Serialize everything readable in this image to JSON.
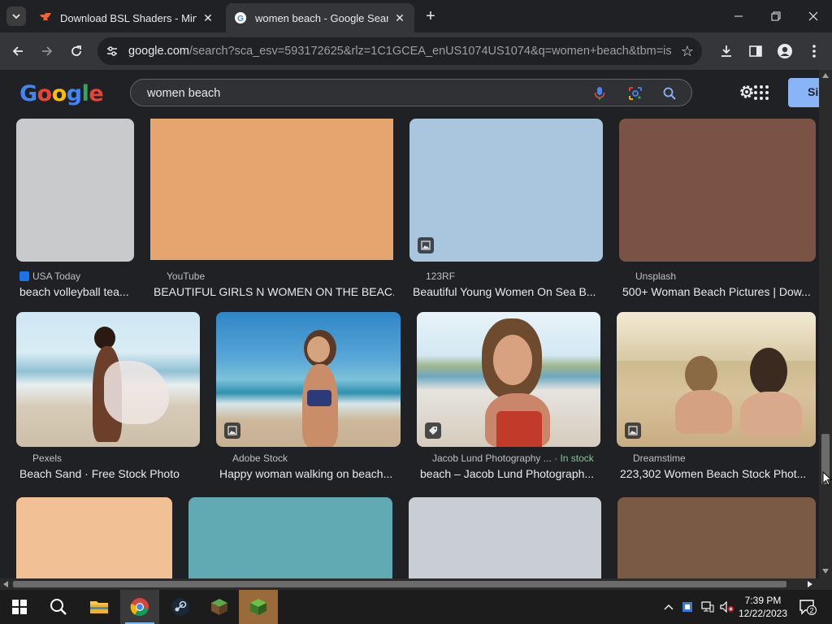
{
  "browser": {
    "tabs": [
      {
        "title": "Download BSL Shaders - Minec",
        "active": false
      },
      {
        "title": "women beach - Google Search",
        "active": true
      }
    ],
    "url_host": "google.com",
    "url_path": "/search?sca_esv=593172625&rlz=1C1GCEA_enUS1074US1074&q=women+beach&tbm=isch&..."
  },
  "google": {
    "logo": "Google",
    "query": "women beach",
    "signin_label": "Si"
  },
  "results": {
    "row1": [
      {
        "source": "USA Today",
        "caption": "beach volleyball tea...",
        "color": "#c8cacc"
      },
      {
        "source": "YouTube",
        "caption": "BEAUTIFUL GIRLS N WOMEN ON THE BEAC...",
        "color": "#e6a46f"
      },
      {
        "source": "123RF",
        "caption": "Beautiful Young Women On Sea B...",
        "color": "#a9c6de"
      },
      {
        "source": "Unsplash",
        "caption": "500+ Woman Beach Pictures | Dow...",
        "color": "#7a5344"
      }
    ],
    "row2": [
      {
        "source": "Pexels",
        "caption": "Beach Sand · Free Stock Photo"
      },
      {
        "source": "Adobe Stock",
        "caption": "Happy woman walking on beach..."
      },
      {
        "source": "Jacob Lund Photography ...",
        "stock": "· In stock",
        "caption": "beach – Jacob Lund Photograph..."
      },
      {
        "source": "Dreamstime",
        "caption": "223,302 Women Beach Stock Phot..."
      }
    ],
    "row3_colors": [
      "#f2c095",
      "#62aab3",
      "#c9cdd4",
      "#7a5a45"
    ]
  },
  "taskbar": {
    "time": "7:39 PM",
    "date": "12/22/2023",
    "notifications": "2"
  }
}
